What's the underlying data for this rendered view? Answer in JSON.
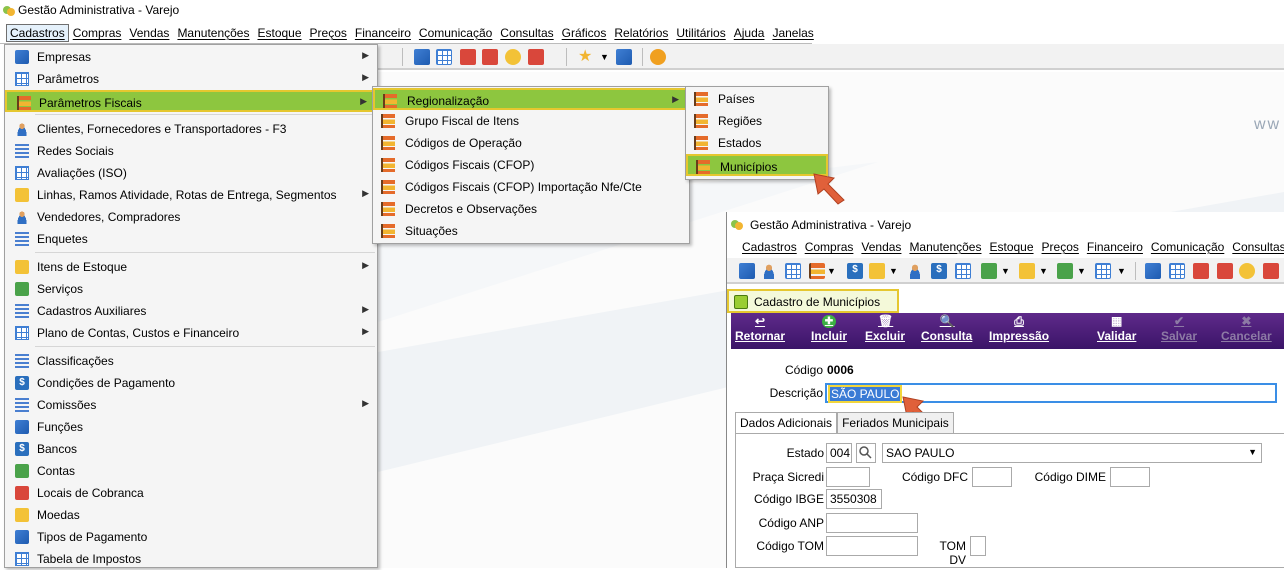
{
  "app": {
    "title": "Gestão Administrativa - Varejo",
    "menubar": [
      "Cadastros",
      "Compras",
      "Vendas",
      "Manutenções",
      "Estoque",
      "Preços",
      "Financeiro",
      "Comunicação",
      "Consultas",
      "Gráficos",
      "Relatórios",
      "Utilitários",
      "Ajuda",
      "Janelas"
    ],
    "watermark": "ww"
  },
  "menu_cadastros": {
    "items": [
      {
        "label": "Empresas",
        "icon": "building-icon",
        "submenu": true
      },
      {
        "label": "Parâmetros",
        "icon": "grid-icon",
        "submenu": true
      },
      {
        "label": "Parâmetros Fiscais",
        "icon": "stack-icon",
        "submenu": true
      },
      {
        "label": "Clientes, Fornecedores e Transportadores - F3",
        "icon": "people-icon",
        "submenu": false
      },
      {
        "label": "Redes Sociais",
        "icon": "network-icon",
        "submenu": false
      },
      {
        "label": "Avaliações (ISO)",
        "icon": "table-icon",
        "submenu": false
      },
      {
        "label": "Linhas, Ramos Atividade, Rotas de Entrega, Segmentos",
        "icon": "tree-icon",
        "submenu": true
      },
      {
        "label": "Vendedores, Compradores",
        "icon": "person-icon",
        "submenu": false
      },
      {
        "label": "Enquetes",
        "icon": "list-icon",
        "submenu": false
      },
      {
        "label": "Itens de Estoque",
        "icon": "box-icon",
        "submenu": true
      },
      {
        "label": "Serviços",
        "icon": "wrench-icon",
        "submenu": false
      },
      {
        "label": "Cadastros Auxiliares",
        "icon": "network-icon",
        "submenu": true
      },
      {
        "label": "Plano de Contas, Custos e Financeiro",
        "icon": "card-icon",
        "submenu": true
      },
      {
        "label": "Classificações",
        "icon": "list-icon",
        "submenu": false
      },
      {
        "label": "Condições de Pagamento",
        "icon": "dollar-icon",
        "submenu": false
      },
      {
        "label": "Comissões",
        "icon": "list-icon",
        "submenu": true
      },
      {
        "label": "Funções",
        "icon": "book-icon",
        "submenu": false
      },
      {
        "label": "Bancos",
        "icon": "bank-icon",
        "submenu": false
      },
      {
        "label": "Contas",
        "icon": "money-icon",
        "submenu": false
      },
      {
        "label": "Locais de Cobranca",
        "icon": "location-icon",
        "submenu": false
      },
      {
        "label": "Moedas",
        "icon": "coins-icon",
        "submenu": false
      },
      {
        "label": "Tipos de Pagamento",
        "icon": "visa-icon",
        "submenu": false
      },
      {
        "label": "Tabela de Impostos",
        "icon": "table-icon",
        "submenu": false
      }
    ]
  },
  "menu_fiscais": {
    "items": [
      "Regionalização",
      "Grupo Fiscal de Itens",
      "Códigos de Operação",
      "Códigos Fiscais (CFOP)",
      "Códigos Fiscais (CFOP)  Importação Nfe/Cte",
      "Decretos e Observações",
      "Situações"
    ]
  },
  "menu_regionalizacao": {
    "items": [
      "Países",
      "Regiões",
      "Estados",
      "Municípios"
    ]
  },
  "window2": {
    "title": "Gestão Administrativa - Varejo",
    "menubar": [
      "Cadastros",
      "Compras",
      "Vendas",
      "Manutenções",
      "Estoque",
      "Preços",
      "Financeiro",
      "Comunicação",
      "Consultas"
    ],
    "form_title": "Cadastro de Municípios",
    "actions": [
      {
        "label": "Retornar",
        "icon": "return-icon",
        "enabled": true
      },
      {
        "label": "Incluir",
        "icon": "plus-icon",
        "enabled": true
      },
      {
        "label": "Excluir",
        "icon": "trash-icon",
        "enabled": true
      },
      {
        "label": "Consulta",
        "icon": "search-icon",
        "enabled": true
      },
      {
        "label": "Impressão",
        "icon": "printer-icon",
        "enabled": true
      },
      {
        "label": "Validar",
        "icon": "validate-icon",
        "enabled": true
      },
      {
        "label": "Salvar",
        "icon": "check-icon",
        "enabled": false
      },
      {
        "label": "Cancelar",
        "icon": "close-icon",
        "enabled": false
      }
    ],
    "codigo_label": "Código",
    "codigo_value": "0006",
    "descricao_label": "Descrição",
    "descricao_value": "SÃO PAULO",
    "tabs": [
      "Dados Adicionais",
      "Feriados Municipais"
    ],
    "estado_label": "Estado",
    "estado_code": "004",
    "estado_name": "SAO PAULO",
    "praca_label": "Praça Sicredi",
    "praca_value": "",
    "dfc_label": "Código DFC",
    "dfc_value": "",
    "dime_label": "Código DIME",
    "dime_value": "",
    "ibge_label": "Código IBGE",
    "ibge_value": "3550308",
    "anp_label": "Código ANP",
    "anp_value": "",
    "tom_label": "Código TOM",
    "tom_value": "",
    "tomdv_label": "TOM DV",
    "tomdv_value": ""
  },
  "colors": {
    "highlight": "#8dc63f",
    "highlight_border": "#e5c72f",
    "action_bar": "#4a1d78",
    "arrow": "#e0603a"
  }
}
